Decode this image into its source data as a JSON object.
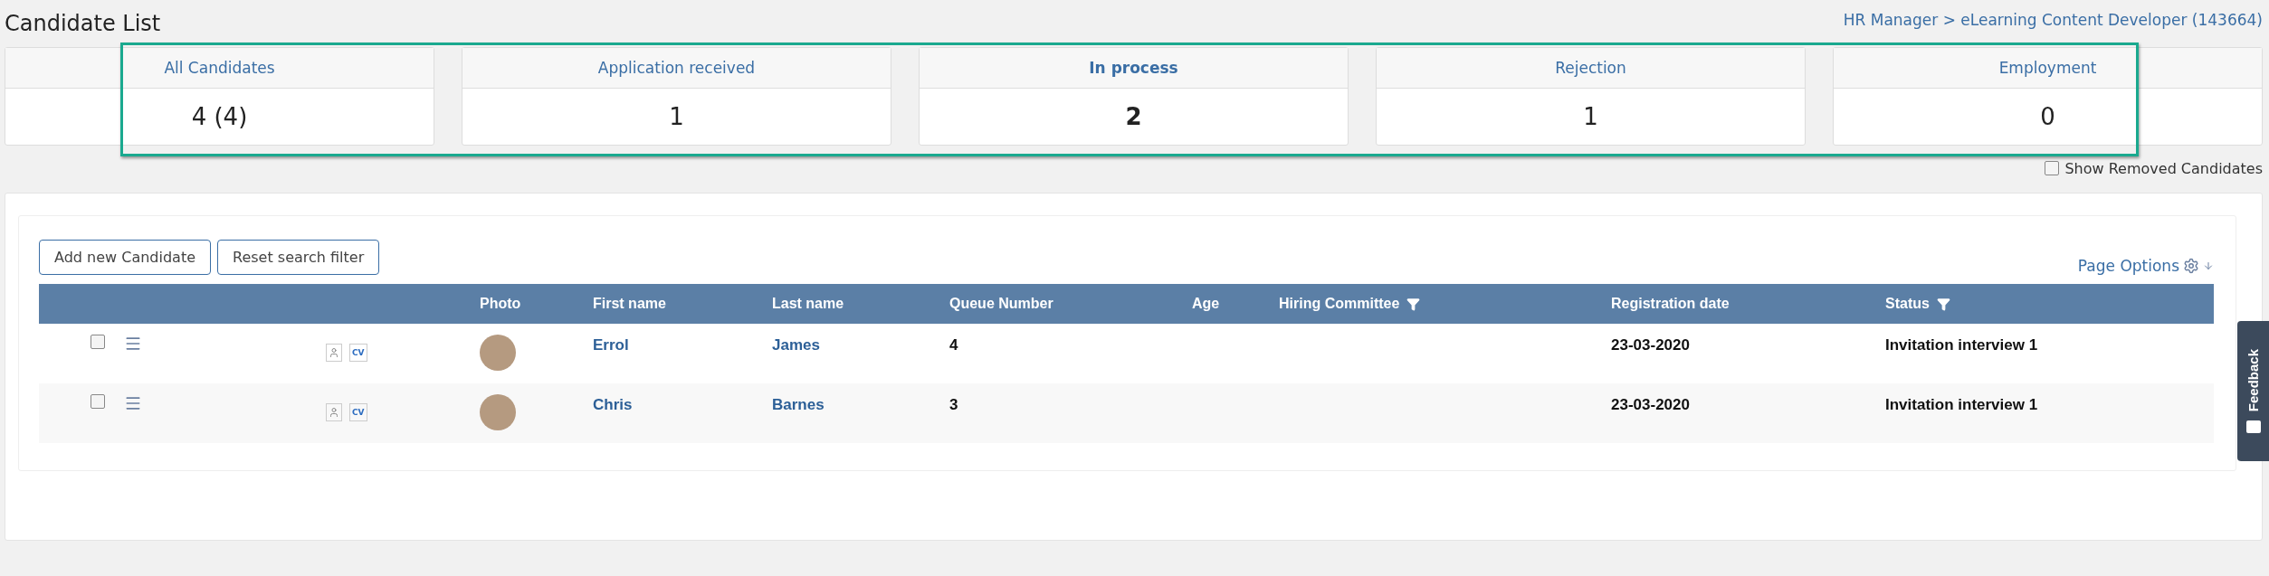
{
  "title": "Candidate List",
  "breadcrumb": "HR Manager > eLearning Content Developer (143664)",
  "stages": [
    {
      "label": "All Candidates",
      "value": "4 (4)",
      "selected": false
    },
    {
      "label": "Application received",
      "value": "1",
      "selected": false
    },
    {
      "label": "In process",
      "value": "2",
      "selected": true
    },
    {
      "label": "Rejection",
      "value": "1",
      "selected": false
    },
    {
      "label": "Employment",
      "value": "0",
      "selected": false
    }
  ],
  "show_removed": {
    "label": "Show Removed Candidates",
    "checked": false
  },
  "buttons": [
    "Add new Candidate",
    "Reset search filter"
  ],
  "page_options": "Page Options",
  "table": {
    "columns": [
      {
        "label": "Photo",
        "filter": false
      },
      {
        "label": "First name",
        "filter": false
      },
      {
        "label": "Last name",
        "filter": false
      },
      {
        "label": "Queue Number",
        "filter": false
      },
      {
        "label": "Age",
        "filter": false
      },
      {
        "label": "Hiring Committee",
        "filter": true
      },
      {
        "label": "Registration date",
        "filter": false
      },
      {
        "label": "Status",
        "filter": true
      }
    ],
    "rows": [
      {
        "checked": false,
        "cv": "CV",
        "first": "Errol",
        "last": "James",
        "queue": "4",
        "date": "23-03-2020",
        "status": "Invitation interview 1"
      },
      {
        "checked": false,
        "cv": "CV",
        "first": "Chris",
        "last": "Barnes",
        "queue": "3",
        "date": "23-03-2020",
        "status": "Invitation interview 1"
      }
    ]
  },
  "feedback": "Feedback"
}
